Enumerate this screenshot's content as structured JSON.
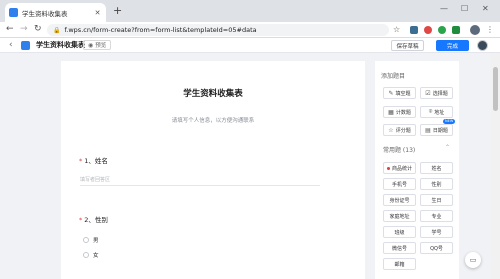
{
  "browser": {
    "tab_title": "学生资料收集表",
    "url": "f.wps.cn/form-create?from=form-list&templateId=05#data",
    "controls": {
      "minimize": "—",
      "maximize": "☐",
      "close": "✕"
    }
  },
  "header": {
    "form_title": "学生资料收集表",
    "preview_label": "预览",
    "save_draft_label": "保存草稿",
    "done_label": "完成"
  },
  "form": {
    "title": "学生资料收集表",
    "description": "请填写个人信息，以方便沟通联系",
    "questions": [
      {
        "number": "1、",
        "label": "姓名",
        "required": true,
        "placeholder": "填写者回答区"
      },
      {
        "number": "2、",
        "label": "性别",
        "required": true,
        "options": [
          "男",
          "女"
        ]
      }
    ]
  },
  "panel": {
    "add_heading": "添加题目",
    "types": [
      {
        "label": "填空题",
        "icon": "edit-icon"
      },
      {
        "label": "选择题",
        "icon": "checkbox-icon"
      },
      {
        "label": "计数题",
        "icon": "counter-icon"
      },
      {
        "label": "地址",
        "icon": "location-icon"
      },
      {
        "label": "评分题",
        "icon": "star-icon"
      },
      {
        "label": "日期题",
        "icon": "calendar-icon",
        "badge": "NEW"
      }
    ],
    "common_heading": "常用题 (13)",
    "common": [
      "商品统计",
      "姓名",
      "手机号",
      "性别",
      "身份证号",
      "生日",
      "家庭地址",
      "专业",
      "班级",
      "学号",
      "微信号",
      "QQ号",
      "邮箱"
    ]
  },
  "colors": {
    "accent": "#1677ff",
    "required": "#e63c3c"
  }
}
